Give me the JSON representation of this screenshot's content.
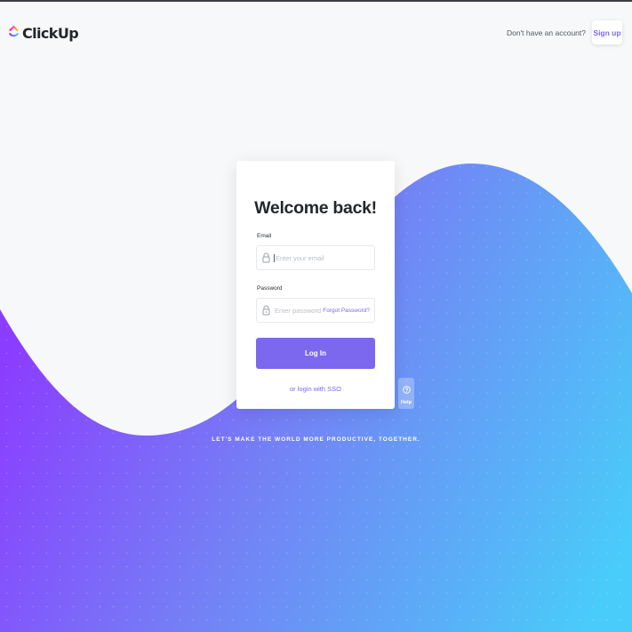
{
  "brand": {
    "name": "ClickUp"
  },
  "header": {
    "no_account_text": "Don't have an account?",
    "signup_label": "Sign up"
  },
  "card": {
    "title": "Welcome back!",
    "email": {
      "label": "Email",
      "placeholder": "Enter your email"
    },
    "password": {
      "label": "Password",
      "placeholder": "Enter password",
      "forgot_label": "Forgot Password?"
    },
    "login_label": "Log In",
    "sso_label": "or login with SSO"
  },
  "help": {
    "label": "Help"
  },
  "tagline": "LET'S MAKE THE WORLD MORE PRODUCTIVE, TOGETHER.",
  "colors": {
    "accent": "#7b68ee",
    "gradient_start": "#8b3dff",
    "gradient_end": "#49ccf9"
  },
  "icons": [
    "clickup-logo-icon",
    "lock-icon",
    "lock-icon",
    "help-icon"
  ]
}
